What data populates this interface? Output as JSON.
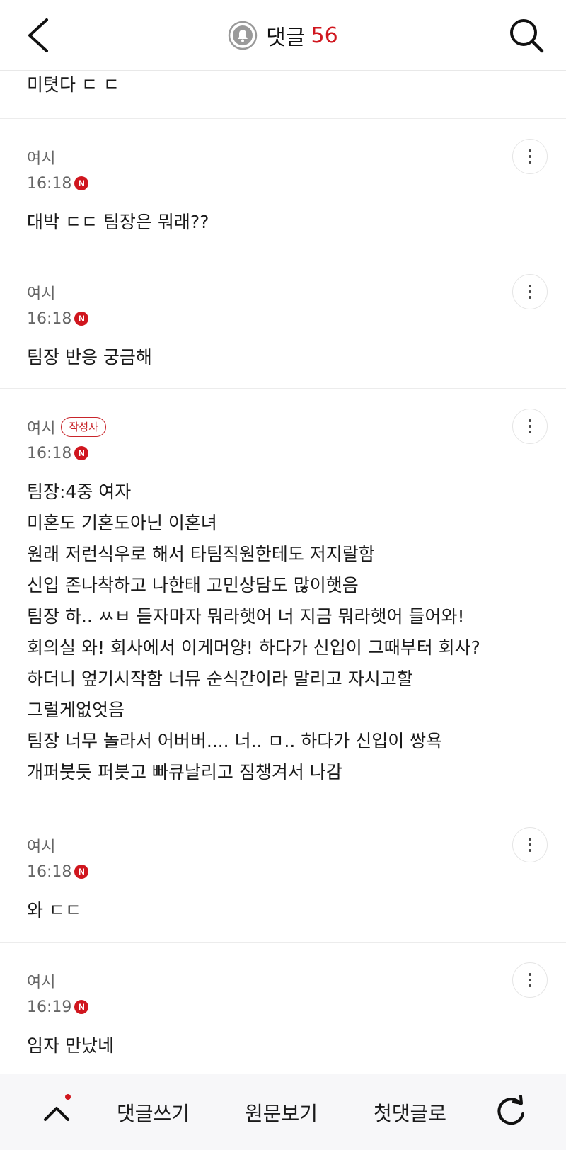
{
  "header": {
    "title": "댓글",
    "count": "56",
    "icons": {
      "back": "chevron-left-icon",
      "bell": "bell-icon",
      "search": "search-icon"
    }
  },
  "top_partial": {
    "text": "미텻다 ㄷ ㄷ"
  },
  "comments": [
    {
      "author": "여시",
      "is_writer": false,
      "time": "16:18",
      "new_badge": "N",
      "text": "대박 ㄷㄷ 팀장은 뭐래??"
    },
    {
      "author": "여시",
      "is_writer": false,
      "time": "16:18",
      "new_badge": "N",
      "text": "팀장 반응 궁금해"
    },
    {
      "author": "여시",
      "is_writer": true,
      "writer_label": "작성자",
      "time": "16:18",
      "new_badge": "N",
      "text": "팀장:4중 여자\n미혼도 기혼도아닌 이혼녀\n원래 저런식우로 해서 타팀직원한테도 저지랄함\n신입 존나착하고 나한태 고민상담도 많이햇음\n팀장 하.. ㅆㅂ 듣자마자 뭐라햇어 너 지금 뭐라햇어 들어와!\n회의실 와! 회사에서 이게머양! 하다가 신입이 그때부터 회사?\n하더니 엎기시작함 너뮤 순식간이라 말리고 자시고할\n그럴게없엇음\n팀장 너무 놀라서 어버버.... 너.. ㅁ.. 하다가 신입이 쌍욕\n개퍼붓듯 퍼븟고 빠큐날리고 짐챙겨서 나감"
    },
    {
      "author": "여시",
      "is_writer": false,
      "time": "16:18",
      "new_badge": "N",
      "text": "와 ㄷㄷ"
    },
    {
      "author": "여시",
      "is_writer": false,
      "time": "16:19",
      "new_badge": "N",
      "text": "임자 만났네"
    }
  ],
  "bottom_bar": {
    "write_label": "댓글쓰기",
    "original_label": "원문보기",
    "first_label": "첫댓글로",
    "icons": {
      "up": "chevron-up-icon",
      "refresh": "refresh-icon"
    }
  },
  "colors": {
    "accent": "#d0161e",
    "meta_text": "#666666",
    "divider": "#ececec",
    "bottom_bg": "#f7f7f9"
  }
}
